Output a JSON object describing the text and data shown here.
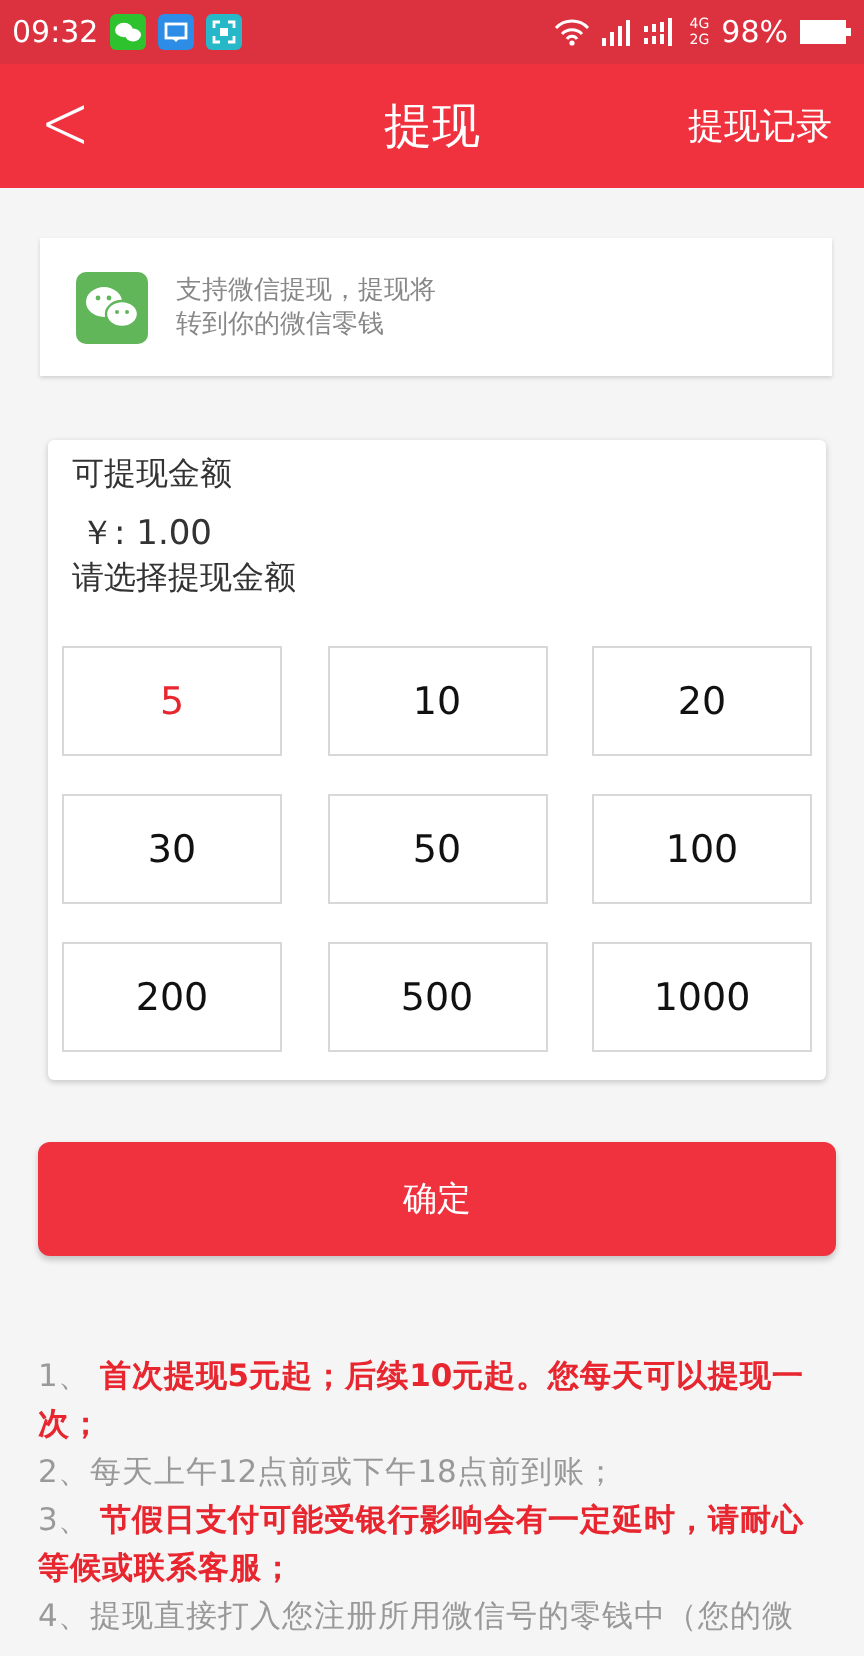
{
  "status_bar": {
    "time": "09:32",
    "network_top": "4G",
    "network_bottom": "2G",
    "battery": "98%"
  },
  "nav": {
    "back": "<",
    "title": "提现",
    "action": "提现记录"
  },
  "payment_method": {
    "lines": [
      "支持微信提现，提现将",
      "转到你的微信零钱"
    ]
  },
  "balance": {
    "label": "可提现金额",
    "value": "￥: 1.00",
    "prompt": "请选择提现金额"
  },
  "amounts": [
    {
      "label": "5",
      "selected": true
    },
    {
      "label": "10",
      "selected": false
    },
    {
      "label": "20",
      "selected": false
    },
    {
      "label": "30",
      "selected": false
    },
    {
      "label": "50",
      "selected": false
    },
    {
      "label": "100",
      "selected": false
    },
    {
      "label": "200",
      "selected": false
    },
    {
      "label": "500",
      "selected": false
    },
    {
      "label": "1000",
      "selected": false
    }
  ],
  "confirm_button": "确定",
  "notes": [
    {
      "number": "1、 ",
      "text": "首次提现5元起；后续10元起。您每天可以提现一次；",
      "emphasis": true
    },
    {
      "number": "2、",
      "text": "每天上午12点前或下午18点前到账；",
      "emphasis": false
    },
    {
      "number": "3、 ",
      "text": "节假日支付可能受银行影响会有一定延时，请耐心等候或联系客服；",
      "emphasis": true
    },
    {
      "number": "4、",
      "text": "提现直接打入您注册所用微信号的零钱中（您的微",
      "emphasis": false
    }
  ]
}
